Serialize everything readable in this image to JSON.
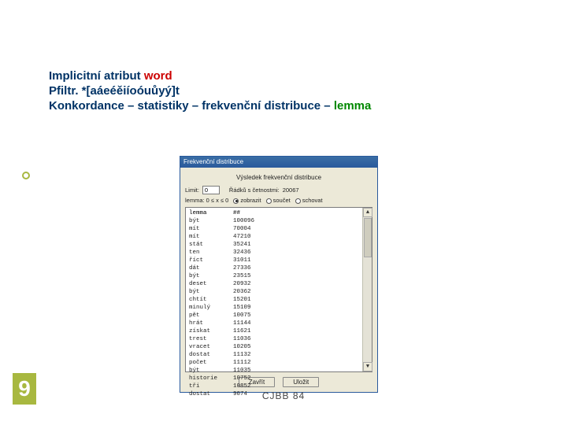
{
  "header": {
    "line1_a": "Implicitní atribut ",
    "line1_b": "word",
    "line2": "Pfiltr. *[aáeéěiíoóuůyý]t",
    "line3_a": " Konkordance – statistiky – frekvenční distribuce – ",
    "line3_b": "lemma"
  },
  "dialog": {
    "title": "Frekvenční distribuce",
    "caption": "Výsledek frekvenční distribuce",
    "limit_label": "Limit:",
    "limit_value": "0",
    "hint_label": "Řádků s četnostmi:",
    "hint_value": "20067",
    "hint2_a": "lemma: 0 ≤ x ≤ 0",
    "radio": [
      {
        "label": "zobrazit",
        "checked": true
      },
      {
        "label": "součet",
        "checked": false
      },
      {
        "label": "schovat",
        "checked": false
      }
    ],
    "list_header": {
      "c1": "lemma",
      "c2": "##"
    },
    "rows": [
      {
        "c1": "být",
        "c2": "100096"
      },
      {
        "c1": "mít",
        "c2": "70004"
      },
      {
        "c1": "mít",
        "c2": "47210"
      },
      {
        "c1": "stát",
        "c2": "35241"
      },
      {
        "c1": "ten",
        "c2": "32436"
      },
      {
        "c1": "říct",
        "c2": "31011"
      },
      {
        "c1": "dát",
        "c2": "27336"
      },
      {
        "c1": "být",
        "c2": "23515"
      },
      {
        "c1": "deset",
        "c2": "20932"
      },
      {
        "c1": "být",
        "c2": "20362"
      },
      {
        "c1": "chtít",
        "c2": "15201"
      },
      {
        "c1": "minulý",
        "c2": "15109"
      },
      {
        "c1": "pět",
        "c2": "10075"
      },
      {
        "c1": "hrát",
        "c2": "11144"
      },
      {
        "c1": "získat",
        "c2": "11621"
      },
      {
        "c1": "trest",
        "c2": "11036"
      },
      {
        "c1": "vracet",
        "c2": "10205"
      },
      {
        "c1": "dostat",
        "c2": "11132"
      },
      {
        "c1": "počet",
        "c2": "11112"
      },
      {
        "c1": "být",
        "c2": "11035"
      },
      {
        "c1": "historie",
        "c2": "10752"
      },
      {
        "c1": "tři",
        "c2": "10852"
      },
      {
        "c1": "dostat",
        "c2": "9074"
      }
    ],
    "buttons": {
      "close": "Zavřít",
      "save": "Uložit"
    }
  },
  "footer": "CJBB 84",
  "slide_number": "9",
  "chart_data": {
    "type": "table",
    "title": "Výsledek frekvenční distribuce",
    "columns": [
      "lemma",
      "##"
    ],
    "rows": [
      [
        "být",
        100096
      ],
      [
        "mít",
        70004
      ],
      [
        "mít",
        47210
      ],
      [
        "stát",
        35241
      ],
      [
        "ten",
        32436
      ],
      [
        "říct",
        31011
      ],
      [
        "dát",
        27336
      ],
      [
        "být",
        23515
      ],
      [
        "deset",
        20932
      ],
      [
        "být",
        20362
      ],
      [
        "chtít",
        15201
      ],
      [
        "minulý",
        15109
      ],
      [
        "pět",
        10075
      ],
      [
        "hrát",
        11144
      ],
      [
        "získat",
        11621
      ],
      [
        "trest",
        11036
      ],
      [
        "vracet",
        10205
      ],
      [
        "dostat",
        11132
      ],
      [
        "počet",
        11112
      ],
      [
        "být",
        11035
      ],
      [
        "historie",
        10752
      ],
      [
        "tři",
        10852
      ],
      [
        "dostat",
        9074
      ]
    ]
  }
}
